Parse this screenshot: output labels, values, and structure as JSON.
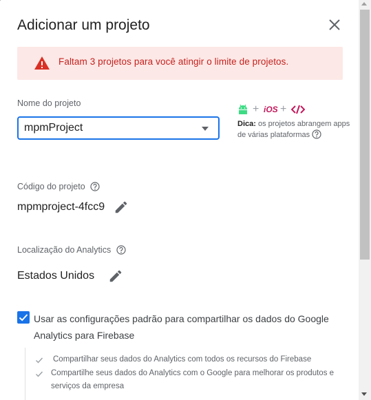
{
  "dialog": {
    "title": "Adicionar um projeto",
    "warning": "Faltam 3 projetos para você atingir o limite de projetos."
  },
  "project_name": {
    "label": "Nome do projeto",
    "value": "mpmProject"
  },
  "platforms": {
    "plus": "+",
    "ios": "iOS",
    "tip_bold": "Dica:",
    "tip_text": " os projetos abrangem apps de várias plataformas"
  },
  "project_code": {
    "label": "Código do projeto",
    "value": "mpmproject-4fcc9"
  },
  "analytics_location": {
    "label": "Localização do Analytics",
    "value": "Estados Unidos"
  },
  "analytics_sharing": {
    "checked": true,
    "label": "Usar as configurações padrão para compartilhar os dados do Google Analytics para Firebase",
    "items": [
      "Compartilhar seus dados do Analytics com todos os recursos do Firebase",
      "Compartilhe seus dados do Analytics com o Google para melhorar os produtos e serviços da empresa"
    ]
  },
  "colors": {
    "accent": "#1a73e8",
    "error": "#c5221f",
    "android": "#3ddc84",
    "web": "#c2185b"
  }
}
